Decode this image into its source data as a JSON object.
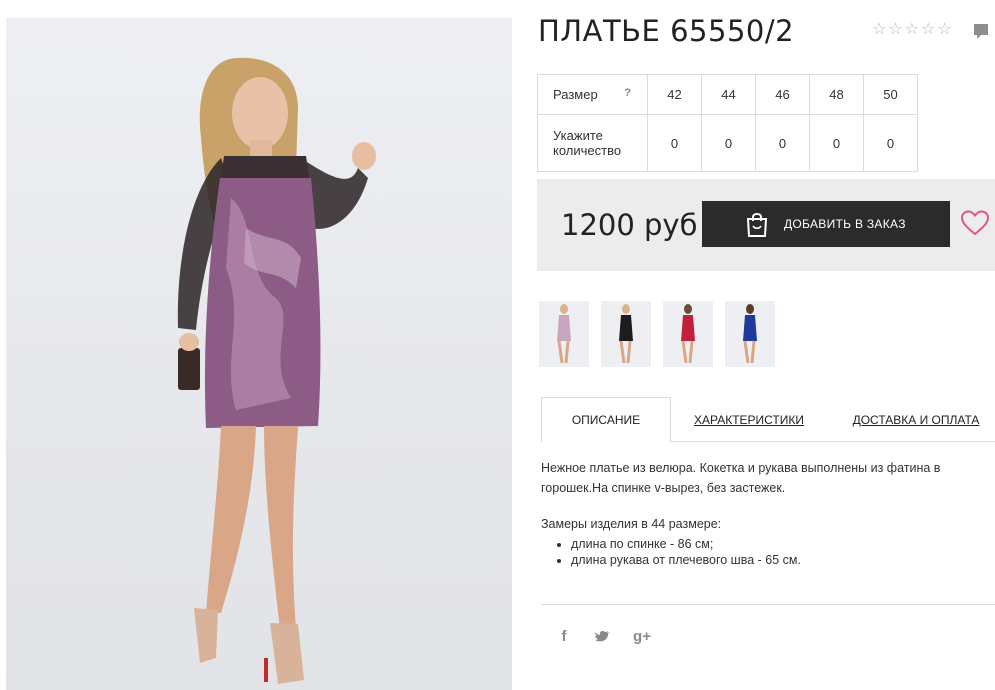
{
  "product": {
    "title": "ПЛАТЬЕ 65550/2",
    "rating_stars": 5,
    "rating_value": 0
  },
  "size_table": {
    "size_label": "Размер",
    "help_mark": "?",
    "sizes": [
      "42",
      "44",
      "46",
      "48",
      "50"
    ],
    "quantity_label": "Укажите количество",
    "quantities": [
      "0",
      "0",
      "0",
      "0",
      "0"
    ]
  },
  "purchase": {
    "price": "1200 руб",
    "order_button": "ДОБАВИТЬ В ЗАКАЗ"
  },
  "thumbnails": [
    {
      "color": "#c9a6bf"
    },
    {
      "color": "#1c1c1c"
    },
    {
      "color": "#c0203a"
    },
    {
      "color": "#1f3a9a"
    }
  ],
  "tabs": {
    "description": "ОПИСАНИЕ",
    "characteristics": "ХАРАКТЕРИСТИКИ",
    "delivery": "ДОСТАВКА И ОПЛАТА"
  },
  "description": {
    "text": "Нежное платье из велюра. Кокетка и рукава выполнены из фатина в горошек.На спинке v-вырез, без застежек.",
    "measurements_title": "Замеры изделия в 44 размере:",
    "measurements": [
      "длина по спинке - 86 см;",
      "длина рукава от плечевого шва - 65 см."
    ]
  },
  "social": {
    "facebook": "f",
    "twitter": "t",
    "googleplus": "g+"
  },
  "colors": {
    "accent_button": "#2b2b2b",
    "heart": "#e0557a",
    "panel": "#ececec"
  }
}
